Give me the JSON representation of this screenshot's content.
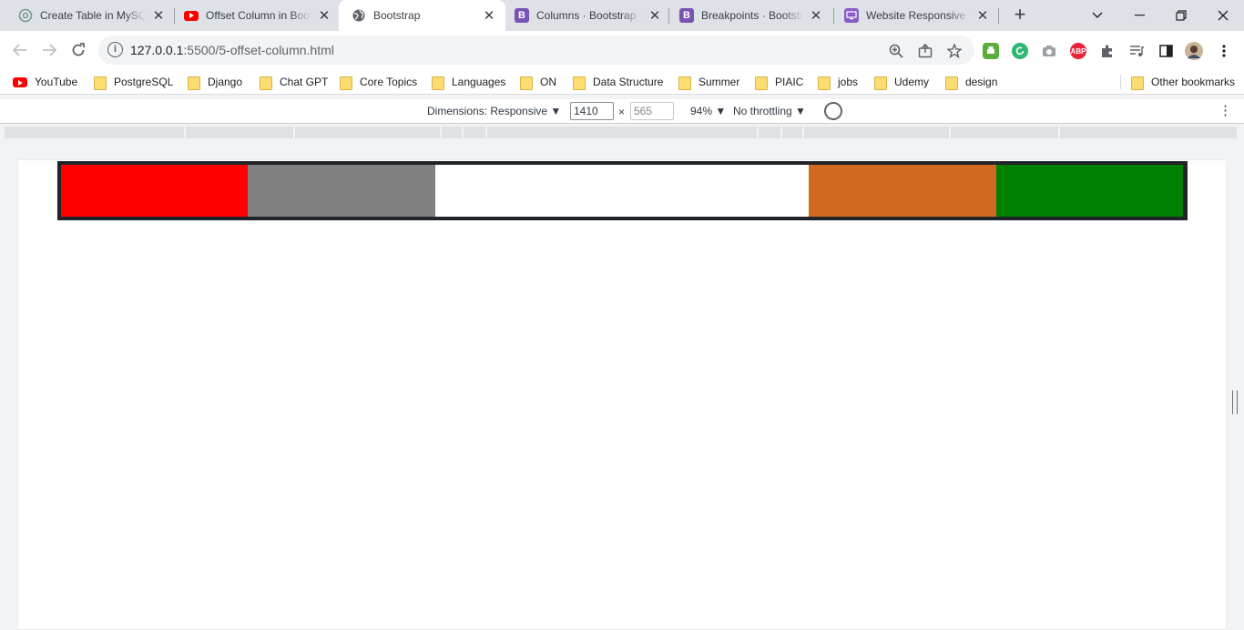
{
  "tabs": [
    {
      "title": "Create Table in MySQL",
      "icon": "chatgpt-icon",
      "active": false
    },
    {
      "title": "Offset Column in Boot",
      "icon": "youtube-icon",
      "active": false
    },
    {
      "title": "Bootstrap",
      "icon": "globe-icon",
      "active": true
    },
    {
      "title": "Columns · Bootstrap v",
      "icon": "bootstrap-icon",
      "active": false
    },
    {
      "title": "Breakpoints · Bootstrap",
      "icon": "bootstrap-icon",
      "active": false
    },
    {
      "title": "Website Responsive Te",
      "icon": "responsive-tester-icon",
      "active": false
    }
  ],
  "address_bar": {
    "host": "127.0.0.1",
    "path": ":5500/5-offset-column.html"
  },
  "extensions": {
    "abp_label": "ABP"
  },
  "bookmarks": [
    {
      "label": "YouTube",
      "icon": "youtube-icon"
    },
    {
      "label": "PostgreSQL",
      "icon": "folder-icon"
    },
    {
      "label": "Django",
      "icon": "folder-icon"
    },
    {
      "label": "Chat GPT",
      "icon": "folder-icon"
    },
    {
      "label": "Core Topics",
      "icon": "folder-icon"
    },
    {
      "label": "Languages",
      "icon": "folder-icon"
    },
    {
      "label": "ON",
      "icon": "folder-icon"
    },
    {
      "label": "Data Structure",
      "icon": "folder-icon"
    },
    {
      "label": "Summer",
      "icon": "folder-icon"
    },
    {
      "label": "PIAIC",
      "icon": "folder-icon"
    },
    {
      "label": "jobs",
      "icon": "folder-icon"
    },
    {
      "label": "Udemy",
      "icon": "folder-icon"
    },
    {
      "label": "design",
      "icon": "folder-icon"
    }
  ],
  "other_bookmarks": "Other bookmarks",
  "device_toolbar": {
    "dimensions_label": "Dimensions: Responsive",
    "width": "1410",
    "height": "565",
    "times": "×",
    "zoom": "94%",
    "throttling": "No throttling"
  },
  "page": {
    "columns": [
      {
        "color": "#ff0000",
        "name": "red"
      },
      {
        "color": "#808080",
        "name": "gray"
      },
      {
        "color": "#ffffff",
        "name": "white"
      },
      {
        "color": "#d2691e",
        "name": "chocolate"
      },
      {
        "color": "#008000",
        "name": "green"
      }
    ],
    "row_background": "#212529"
  }
}
